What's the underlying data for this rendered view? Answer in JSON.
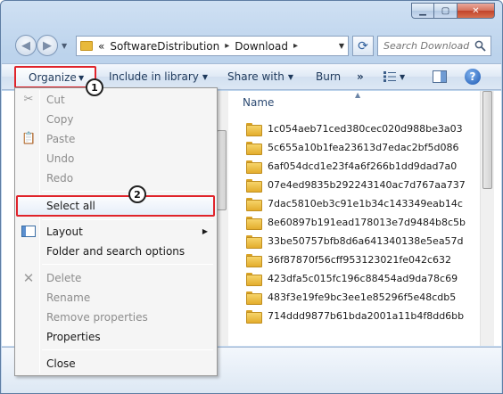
{
  "address": {
    "prefix": "«",
    "crumbs": [
      "SoftwareDistribution",
      "Download"
    ],
    "separator": "▸"
  },
  "search": {
    "placeholder": "Search Download"
  },
  "commandbar": {
    "organize": "Organize",
    "include": "Include in library",
    "share": "Share with",
    "burn": "Burn",
    "more": "»"
  },
  "callouts": [
    "1",
    "2"
  ],
  "menu": {
    "cut": "Cut",
    "copy": "Copy",
    "paste": "Paste",
    "undo": "Undo",
    "redo": "Redo",
    "select_all": "Select all",
    "layout": "Layout",
    "folder_options": "Folder and search options",
    "delete": "Delete",
    "rename": "Rename",
    "remove_properties": "Remove properties",
    "properties": "Properties",
    "close": "Close"
  },
  "filepane": {
    "column_name": "Name",
    "files": [
      "1c054aeb71ced380cec020d988be3a03",
      "5c655a10b1fea23613d7edac2bf5d086",
      "6af054dcd1e23f4a6f266b1dd9dad7a0",
      "07e4ed9835b292243140ac7d767aa737",
      "7dac5810eb3c91e1b34c143349eab14c",
      "8e60897b191ead178013e7d9484b8c5b",
      "33be50757bfb8d6a641340138e5ea57d",
      "36f87870f56cff953123021fe042c632",
      "423dfa5c015fc196c88454ad9da78c69",
      "483f3e19fe9bc3ee1e85296f5e48cdb5",
      "714ddd9877b61bda2001a11b4f8dd6bb"
    ]
  },
  "colors": {
    "highlight_border": "#e0242b",
    "folder": "#e3ad2d"
  }
}
